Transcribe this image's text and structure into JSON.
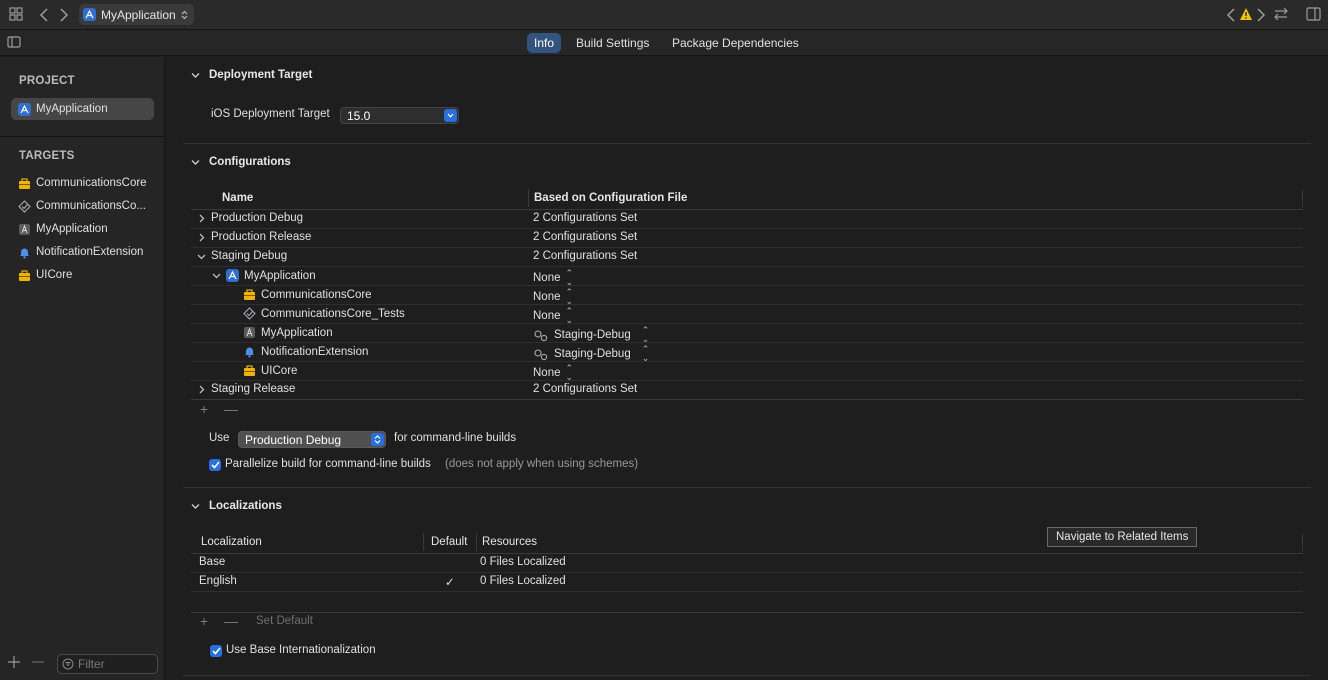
{
  "toolbar": {
    "scheme": "MyApplication",
    "icons": [
      "grid-icon",
      "back-icon",
      "forward-icon",
      "warning-icon",
      "swap-icon",
      "inspector-icon"
    ]
  },
  "tabs": [
    "Info",
    "Build Settings",
    "Package Dependencies"
  ],
  "sidebar": {
    "project_header": "PROJECT",
    "project": "MyApplication",
    "targets_header": "TARGETS",
    "targets": [
      "CommunicationsCore",
      "CommunicationsCo...",
      "MyApplication",
      "NotificationExtension",
      "UICore"
    ],
    "filter_placeholder": "Filter"
  },
  "deployment": {
    "title": "Deployment Target",
    "label": "iOS Deployment Target",
    "value": "15.0"
  },
  "configurations": {
    "title": "Configurations",
    "col_name": "Name",
    "col_based": "Based on Configuration File",
    "rows": [
      {
        "name": "Production Debug",
        "value": "2 Configurations Set"
      },
      {
        "name": "Production Release",
        "value": "2 Configurations Set"
      },
      {
        "name": "Staging Debug",
        "value": "2 Configurations Set"
      },
      {
        "name": "MyApplication",
        "value": "None"
      },
      {
        "name": "CommunicationsCore",
        "value": "None"
      },
      {
        "name": "CommunicationsCore_Tests",
        "value": "None"
      },
      {
        "name": "MyApplication",
        "value": "Staging-Debug"
      },
      {
        "name": "NotificationExtension",
        "value": "Staging-Debug"
      },
      {
        "name": "UICore",
        "value": "None"
      },
      {
        "name": "Staging Release",
        "value": "2 Configurations Set"
      }
    ],
    "use_label": "Use",
    "use_value": "Production Debug",
    "use_suffix": "for command-line builds",
    "parallelize_label": "Parallelize build for command-line builds",
    "parallelize_note": "(does not apply when using schemes)"
  },
  "localizations": {
    "title": "Localizations",
    "col_loc": "Localization",
    "col_default": "Default",
    "col_resources": "Resources",
    "rows": [
      {
        "name": "Base",
        "default": "",
        "resources": "0 Files Localized"
      },
      {
        "name": "English",
        "default": "✓",
        "resources": "0 Files Localized"
      }
    ],
    "set_default": "Set Default",
    "use_base_label": "Use Base Internationalization"
  },
  "tooltip": "Navigate to Related Items",
  "colors": {
    "accent": "#2a6fe0",
    "warning": "#f5c400",
    "toolbox": "#f0b400"
  }
}
